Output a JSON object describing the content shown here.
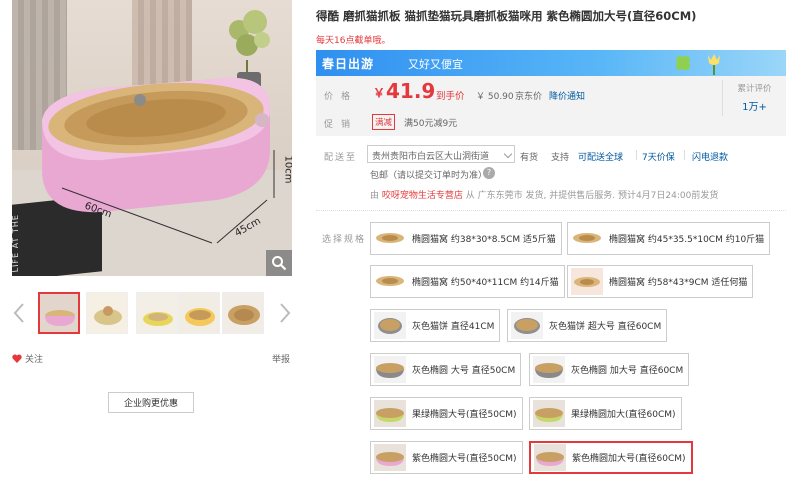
{
  "product": {
    "title": "得酷 磨抓猫抓板 猫抓垫猫玩具磨抓板猫咪用 紫色椭圆加大号(直径60CM)",
    "note": "每天16点截单哦。"
  },
  "gallery": {
    "dim_length": "60cm",
    "dim_width": "45cm",
    "dim_height": "10cm",
    "rug_text": "LIFE AT THE",
    "thumbnails": [
      {
        "caption": "",
        "selected": true
      },
      {
        "caption": "",
        "selected": false
      },
      {
        "caption": "",
        "selected": false
      },
      {
        "caption": "",
        "selected": false
      },
      {
        "caption": "",
        "selected": false
      }
    ]
  },
  "actions": {
    "follow": "关注",
    "report": "举报",
    "corporate": "企业购更优惠"
  },
  "banner": {
    "title": "春日出游",
    "subtitle": "又好又便宜",
    "color_from": "#2f8ff0",
    "color_to": "#9bd6f8"
  },
  "price": {
    "label": "价格",
    "currency": "￥",
    "value": "41.9",
    "tag": "到手价",
    "original": "￥ 50.90",
    "original_label": "京东价",
    "notify": "降价通知",
    "accent_color": "#e4393c"
  },
  "reviews": {
    "label": "累计评价",
    "count": "1万+"
  },
  "promotion": {
    "label": "促销",
    "tag": "满减",
    "text": "满50元减9元"
  },
  "shipping": {
    "label": "配送至",
    "address": "贵州贵阳市白云区大山洞街道",
    "stock": "有货",
    "support": "支持",
    "features": [
      "可配送全球",
      "7天价保",
      "闪电退款"
    ],
    "package": "包邮（请以提交订单时为准）",
    "seller_prefix": "由",
    "seller_shop": "咬呀宠物生活专营店",
    "seller_suffix": "从 广东东莞市 发货, 并提供售后服务. 预计4月7日24:00前发货"
  },
  "specs": {
    "label": "选择规格",
    "options": [
      {
        "label": "椭圆猫窝 约38*30*8.5CM 适5斤猫",
        "selected": false
      },
      {
        "label": "椭圆猫窝 约45*35.5*10CM 约10斤猫",
        "selected": false
      },
      {
        "label": "椭圆猫窝 约50*40*11CM 约14斤猫",
        "selected": false
      },
      {
        "label": "椭圆猫窝 约58*43*9CM 适任何猫",
        "selected": false
      },
      {
        "label": "灰色猫饼 直径41CM",
        "selected": false
      },
      {
        "label": "灰色猫饼 超大号 直径60CM",
        "selected": false
      },
      {
        "label": "灰色椭圆 大号 直径50CM",
        "selected": false
      },
      {
        "label": "灰色椭圆 加大号 直径60CM",
        "selected": false
      },
      {
        "label": "果绿椭圆大号(直径50CM)",
        "selected": false
      },
      {
        "label": "果绿椭圆加大(直径60CM)",
        "selected": false
      },
      {
        "label": "紫色椭圆大号(直径50CM)",
        "selected": false
      },
      {
        "label": "紫色椭圆加大号(直径60CM)",
        "selected": true
      }
    ]
  }
}
